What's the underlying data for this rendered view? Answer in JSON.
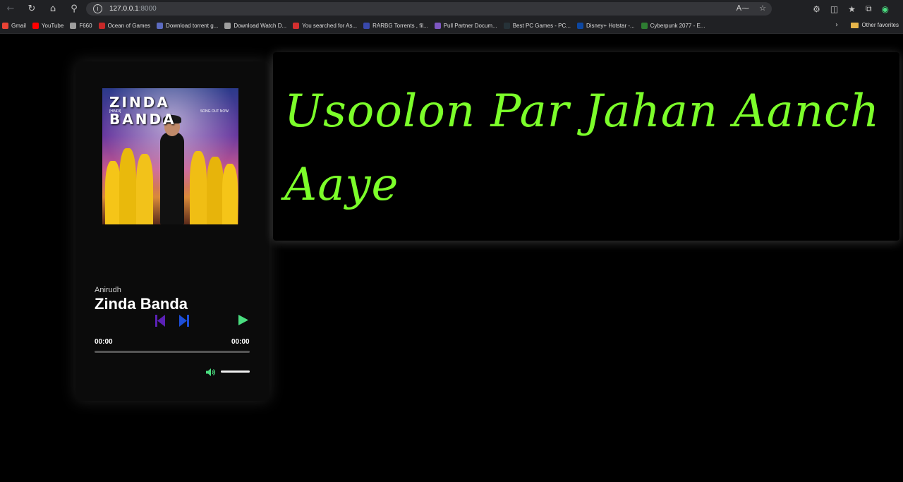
{
  "browser": {
    "url_host": "127.0.0.1",
    "url_port": ":8000",
    "bookmarks": [
      {
        "label": "Gmail",
        "color": "#ea4335"
      },
      {
        "label": "YouTube",
        "color": "#ff0000"
      },
      {
        "label": "F660",
        "color": "#9e9e9e"
      },
      {
        "label": "Ocean of Games",
        "color": "#c62828"
      },
      {
        "label": "Download torrent g...",
        "color": "#5c6bc0"
      },
      {
        "label": "Download Watch D...",
        "color": "#9e9e9e"
      },
      {
        "label": "You searched for As...",
        "color": "#d32f2f"
      },
      {
        "label": "RARBG Torrents , fil...",
        "color": "#3949ab"
      },
      {
        "label": "Pull Partner Docum...",
        "color": "#7e57c2"
      },
      {
        "label": "Best PC Games - PC...",
        "color": "#263238"
      },
      {
        "label": "Disney+ Hotstar -...",
        "color": "#0d47a1"
      },
      {
        "label": "Cyberpunk 2077 - E...",
        "color": "#2e7d32"
      }
    ],
    "other_favorites": "Other favorites"
  },
  "player": {
    "album_title": "ZINDA BANDA",
    "album_sub_left": "[HINDI]",
    "album_sub_right": "SONG OUT NOW",
    "artist": "Anirudh",
    "song": "Zinda Banda",
    "current_time": "00:00",
    "duration": "00:00",
    "progress": 0,
    "volume": 1.0,
    "accent_prev": "#5b21b6",
    "accent_next": "#1d4ed8",
    "accent_play": "#4ade80"
  },
  "lyrics": {
    "line": "Usoolon Par Jahan Aanch Aaye",
    "color": "#7cff2a"
  }
}
